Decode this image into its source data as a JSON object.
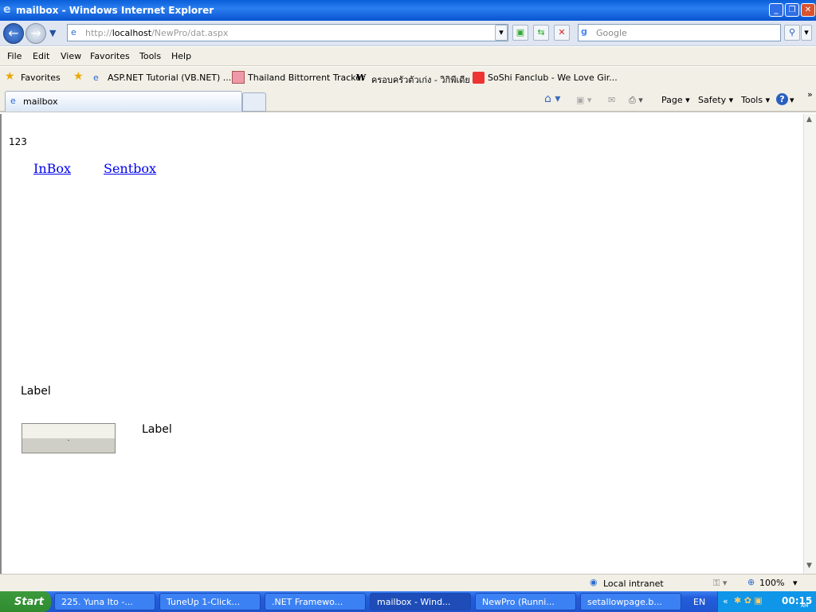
{
  "window": {
    "title": "mailbox - Windows Internet Explorer"
  },
  "nav": {
    "url_prefix": "http://",
    "url_host": "localhost",
    "url_path": "/NewPro/dat.aspx",
    "search_placeholder": "Google"
  },
  "menu": [
    "File",
    "Edit",
    "View",
    "Favorites",
    "Tools",
    "Help"
  ],
  "favorites": {
    "label": "Favorites",
    "items": [
      "ASP.NET Tutorial (VB.NET) ...",
      "Thailand Bittorrent Tracker",
      "ครอบครัวตัวเก่ง - วิกิพีเดีย",
      "SoShi Fanclub - We Love Gir..."
    ]
  },
  "tabs": [
    {
      "label": "mailbox"
    }
  ],
  "commandbar": {
    "page": "Page ▾",
    "safety": "Safety ▾",
    "tools": "Tools ▾",
    "more": "»"
  },
  "page": {
    "number": "123",
    "links": [
      "InBox",
      "Sentbox"
    ],
    "label1": "Label",
    "label2": "Label",
    "button": "."
  },
  "status": {
    "zone": "Local intranet",
    "zoom": "100%"
  },
  "taskbar": {
    "start": "Start",
    "items": [
      "225. Yuna Ito -...",
      "TuneUp 1-Click...",
      ".NET Framewo...",
      "mailbox - Wind...",
      "NewPro (Runni...",
      "setallowpage.b..."
    ],
    "lang": "EN",
    "time": "00:15",
    "ampm": "AM"
  }
}
